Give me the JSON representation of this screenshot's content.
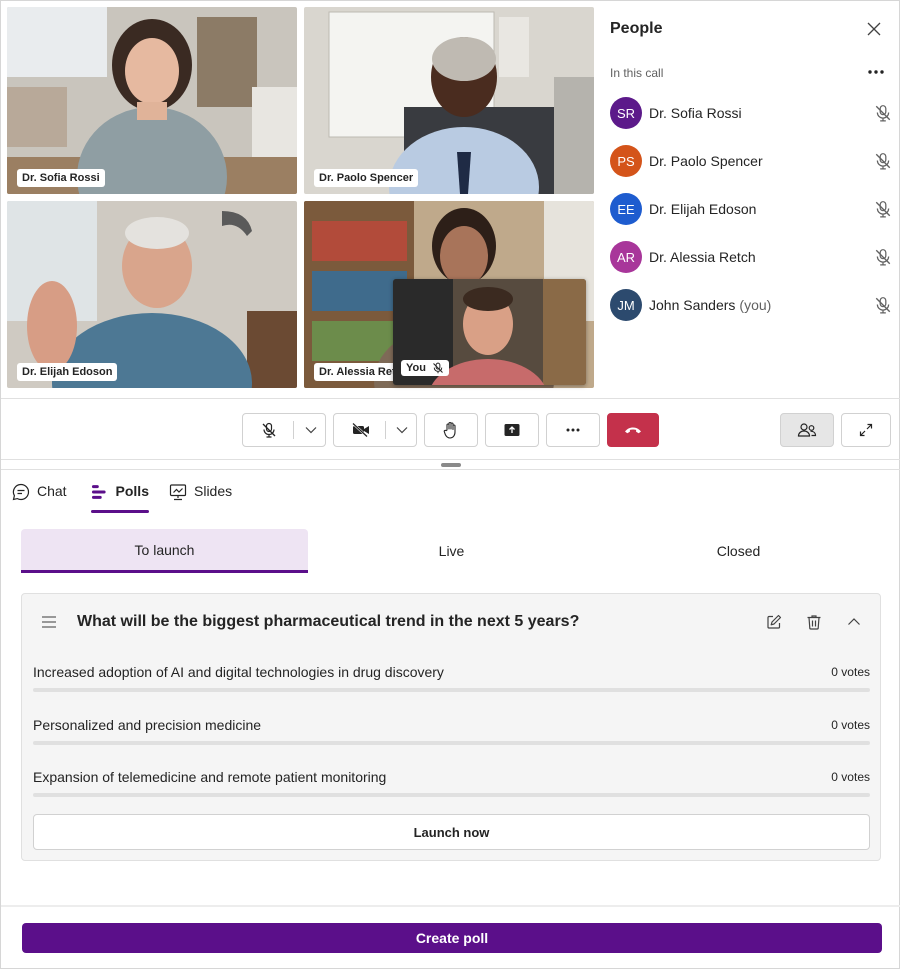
{
  "video": {
    "tiles": [
      {
        "name": "Dr. Sofia Rossi"
      },
      {
        "name": "Dr. Paolo Spencer"
      },
      {
        "name": "Dr. Elijah Edoson"
      },
      {
        "name": "Dr. Alessia Retch"
      }
    ],
    "self_label": "You"
  },
  "people_panel": {
    "title": "People",
    "section_label": "In this call",
    "participants": [
      {
        "initials": "SR",
        "name": "Dr. Sofia Rossi",
        "suffix": "",
        "color": "#5c1a8a",
        "muted": true
      },
      {
        "initials": "PS",
        "name": "Dr. Paolo Spencer",
        "suffix": "",
        "color": "#d4541a",
        "muted": true
      },
      {
        "initials": "EE",
        "name": "Dr. Elijah Edoson",
        "suffix": "",
        "color": "#1e5ccf",
        "muted": true
      },
      {
        "initials": "AR",
        "name": "Dr. Alessia Retch",
        "suffix": "",
        "color": "#a8369a",
        "muted": true
      },
      {
        "initials": "JM",
        "name": "John Sanders",
        "suffix": "(you)",
        "color": "#2c4a6e",
        "muted": true
      }
    ]
  },
  "tabs": [
    {
      "label": "Chat",
      "icon": "chat-icon"
    },
    {
      "label": "Polls",
      "icon": "polls-icon",
      "active": true
    },
    {
      "label": "Slides",
      "icon": "slides-icon"
    }
  ],
  "poll_filters": [
    {
      "label": "To launch",
      "active": true
    },
    {
      "label": "Live"
    },
    {
      "label": "Closed"
    }
  ],
  "poll": {
    "question": "What will be the biggest pharmaceutical trend in the next 5 years?",
    "options": [
      {
        "text": "Increased adoption of AI and digital technologies in drug discovery",
        "votes": "0 votes",
        "fraction": 0
      },
      {
        "text": "Personalized and precision medicine",
        "votes": "0 votes",
        "fraction": 0
      },
      {
        "text": "Expansion of telemedicine and remote patient monitoring",
        "votes": "0 votes",
        "fraction": 0
      }
    ],
    "launch_label": "Launch now"
  },
  "create_label": "Create poll",
  "colors": {
    "accent": "#5b0f8a",
    "hangup": "#c4314b"
  }
}
